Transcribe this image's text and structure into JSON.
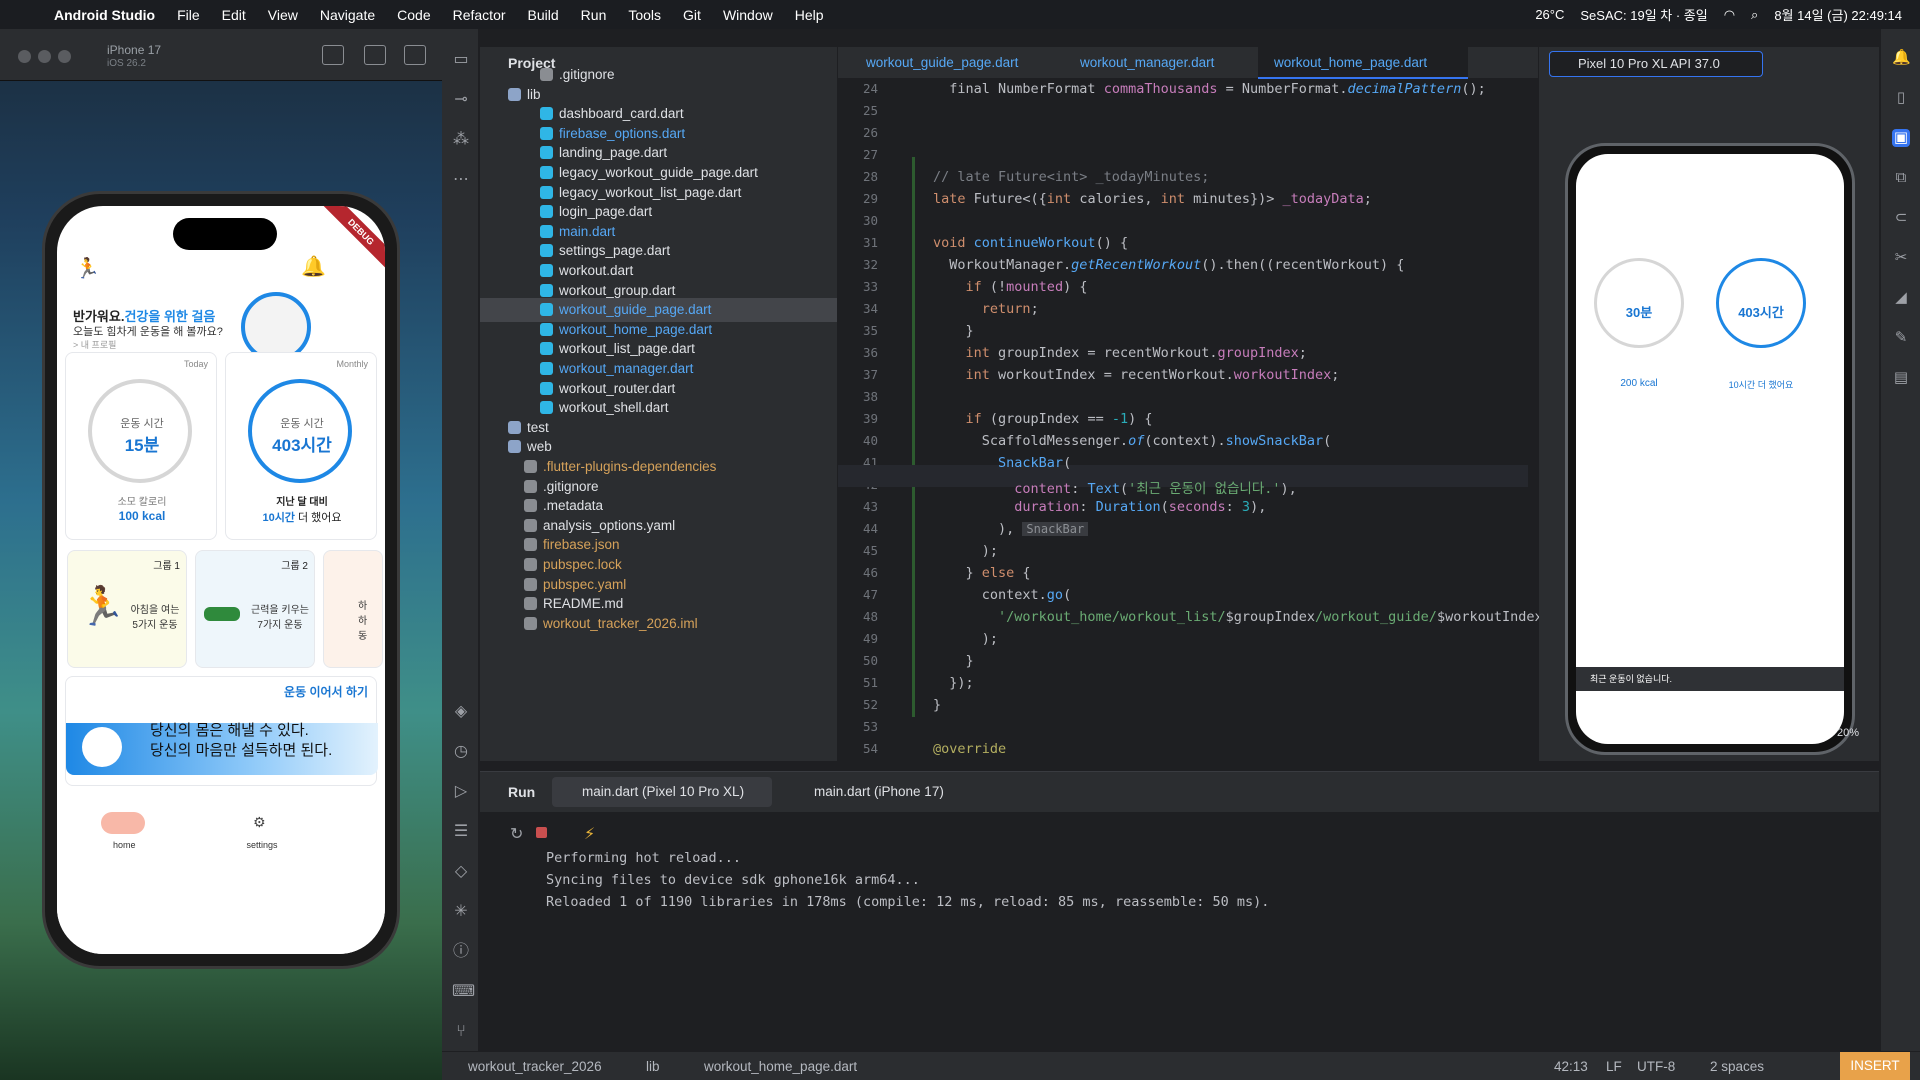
{
  "menubar": {
    "apple": "",
    "app": "Android Studio",
    "items": [
      "File",
      "Edit",
      "View",
      "Navigate",
      "Code",
      "Refactor",
      "Build",
      "Run",
      "Tools",
      "Git",
      "Window",
      "Help"
    ],
    "weather": "26°C",
    "notice": "SeSAC: 19일 차 · 종일",
    "datetime": "8월 14일 (금) 22:49:14"
  },
  "simulator": {
    "title": "iPhone 17",
    "subtitle": "iOS 26.2"
  },
  "app": {
    "debug": "DEBUG",
    "greeting_a": "반가워요.",
    "greeting_b": "건강을 위한 걸음",
    "sub": "오늘도 힘차게 운동을 해 볼까요?",
    "profile": "> 내 프로필",
    "today_tag": "Today",
    "monthly_tag": "Monthly",
    "today_label": "운동 시간",
    "today_value": "15분",
    "cal_label": "소모 칼로리",
    "cal_value": "100 kcal",
    "month_label": "운동 시간",
    "month_value": "403시간",
    "compare_label": "지난 달 대비",
    "compare_value": "10시간",
    "compare_suffix": " 더 했어요",
    "group1": "그룹 1",
    "group1_text": "아침을 여는 5가지 운동",
    "group2": "그룹 2",
    "group2_text": "근력을 키우는 7가지 운동",
    "group3_text": "하 하 동",
    "continue": "운동 이어서 하기",
    "quote1": "당신의 몸은 해낼 수 있다.",
    "quote2": "당신의 마음만 설득하면 된다.",
    "nav_home": "home",
    "nav_settings": "settings"
  },
  "emulator_app": {
    "today_value": "30분",
    "cal_value": "200 kcal",
    "month_value": "403시간",
    "compare": "10시간 더 했어요",
    "snackbar": "최근 운동이 없습니다.",
    "zoom": "20%"
  },
  "project": {
    "header": "Project",
    "files": [
      ".gitignore",
      "lib",
      "dashboard_card.dart",
      "firebase_options.dart",
      "landing_page.dart",
      "legacy_workout_guide_page.dart",
      "legacy_workout_list_page.dart",
      "login_page.dart",
      "main.dart",
      "settings_page.dart",
      "workout.dart",
      "workout_group.dart",
      "workout_guide_page.dart",
      "workout_home_page.dart",
      "workout_list_page.dart",
      "workout_manager.dart",
      "workout_router.dart",
      "workout_shell.dart",
      "test",
      "web",
      ".flutter-plugins-dependencies",
      ".gitignore",
      ".metadata",
      "analysis_options.yaml",
      "firebase.json",
      "pubspec.lock",
      "pubspec.yaml",
      "README.md",
      "workout_tracker_2026.iml"
    ]
  },
  "editor": {
    "tabs": [
      "workout_guide_page.dart",
      "workout_manager.dart",
      "workout_home_page.dart"
    ],
    "hint": "SnackBar",
    "lines": [
      "24",
      "25",
      "26",
      "27",
      "28",
      "29",
      "30",
      "31",
      "32",
      "33",
      "34",
      "35",
      "36",
      "37",
      "38",
      "39",
      "40",
      "41",
      "42",
      "43",
      "44",
      "45",
      "46",
      "47",
      "48",
      "49",
      "50",
      "51",
      "52",
      "53",
      "54"
    ]
  },
  "emulator": {
    "device": "Pixel 10 Pro XL API 37.0"
  },
  "run": {
    "label": "Run",
    "tab1": "main.dart (Pixel 10 Pro XL)",
    "tab2": "main.dart (iPhone 17)",
    "out1": "Performing hot reload...",
    "out2": "Syncing files to device sdk gphone16k arm64...",
    "out3": "Reloaded 1 of 1190 libraries in 178ms (compile: 12 ms, reload: 85 ms, reassemble: 50 ms)."
  },
  "status": {
    "crumb1": "workout_tracker_2026",
    "crumb2": "lib",
    "crumb3": "workout_home_page.dart",
    "pos": "42:13",
    "lf": "LF",
    "enc": "UTF-8",
    "indent": "2 spaces",
    "mode": "INSERT"
  }
}
